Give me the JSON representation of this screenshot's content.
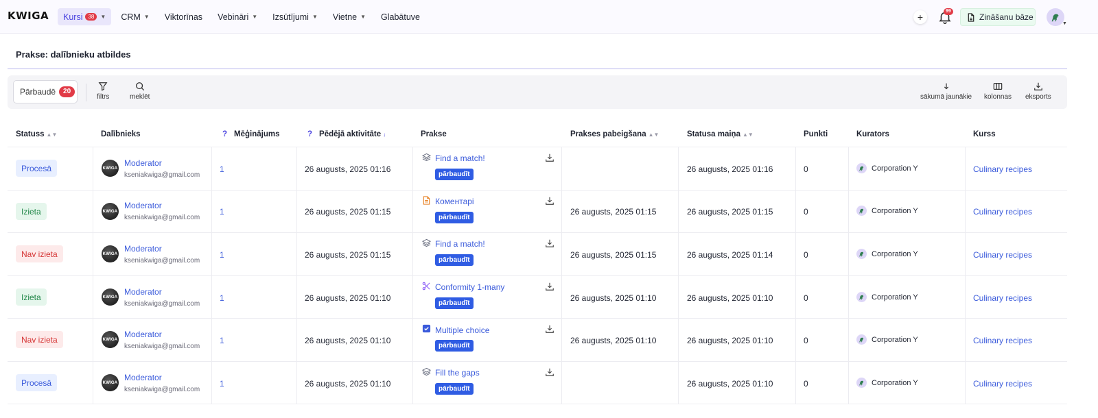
{
  "brand": "KWIGA",
  "nav": [
    {
      "label": "Kursi",
      "badge": "38",
      "chevron": true,
      "active": true
    },
    {
      "label": "CRM",
      "chevron": true
    },
    {
      "label": "Viktorīnas"
    },
    {
      "label": "Vebināri",
      "chevron": true
    },
    {
      "label": "Izsūtījumi",
      "chevron": true
    },
    {
      "label": "Vietne",
      "chevron": true
    },
    {
      "label": "Glabātuve"
    }
  ],
  "header": {
    "plus": "+",
    "notifications_badge": "99",
    "knowledge_base": "Zināšanu bāze"
  },
  "page_title": "Prakse: dalībnieku atbildes",
  "toolbar": {
    "chip_label": "Pārbaudē",
    "chip_count": "20",
    "filter": "filtrs",
    "search": "meklēt",
    "sort": "sākumā jaunākie",
    "columns": "kolonnas",
    "export": "eksports"
  },
  "columns": {
    "status": "Statuss",
    "participant": "Dalībnieks",
    "attempt_q": "?",
    "attempt": "Mēģinājums",
    "activity_q": "?",
    "activity": "Pēdējā aktivitāte",
    "practice": "Prakse",
    "completion": "Prakses pabeigšana",
    "status_change": "Statusa maiņa",
    "points": "Punkti",
    "curator": "Kurators",
    "course": "Kurss"
  },
  "rows": [
    {
      "status": "Procesā",
      "status_type": "proc",
      "name": "Moderator",
      "email": "kseniakwiga@gmail.com",
      "avatar": "KWIGA",
      "attempt": "1",
      "activity": "26 augusts, 2025 01:16",
      "practice": "Find a match!",
      "practice_icon": "layers-icon",
      "check": "pārbaudīt",
      "completion": "",
      "status_change": "26 augusts, 2025 01:16",
      "points": "0",
      "curator": "Corporation Y",
      "course": "Culinary recipes"
    },
    {
      "status": "Izieta",
      "status_type": "ok",
      "name": "Moderator",
      "email": "kseniakwiga@gmail.com",
      "avatar": "KWIGA",
      "attempt": "1",
      "activity": "26 augusts, 2025 01:15",
      "practice": "Коментарі",
      "practice_icon": "document-icon",
      "check": "pārbaudīt",
      "completion": "26 augusts, 2025 01:15",
      "status_change": "26 augusts, 2025 01:15",
      "points": "0",
      "curator": "Corporation Y",
      "course": "Culinary recipes"
    },
    {
      "status": "Nav izieta",
      "status_type": "bad",
      "name": "Moderator",
      "email": "kseniakwiga@gmail.com",
      "avatar": "KWIGA",
      "attempt": "1",
      "activity": "26 augusts, 2025 01:15",
      "practice": "Find a match!",
      "practice_icon": "layers-icon",
      "check": "pārbaudīt",
      "completion": "26 augusts, 2025 01:15",
      "status_change": "26 augusts, 2025 01:14",
      "points": "0",
      "curator": "Corporation Y",
      "course": "Culinary recipes"
    },
    {
      "status": "Izieta",
      "status_type": "ok",
      "name": "Moderator",
      "email": "kseniakwiga@gmail.com",
      "avatar": "KWIGA",
      "attempt": "1",
      "activity": "26 augusts, 2025 01:10",
      "practice": "Conformity 1-many",
      "practice_icon": "conformity-icon",
      "check": "pārbaudīt",
      "completion": "26 augusts, 2025 01:10",
      "status_change": "26 augusts, 2025 01:10",
      "points": "0",
      "curator": "Corporation Y",
      "course": "Culinary recipes"
    },
    {
      "status": "Nav izieta",
      "status_type": "bad",
      "name": "Moderator",
      "email": "kseniakwiga@gmail.com",
      "avatar": "KWIGA",
      "attempt": "1",
      "activity": "26 augusts, 2025 01:10",
      "practice": "Multiple choice",
      "practice_icon": "checkbox-icon",
      "check": "pārbaudīt",
      "completion": "26 augusts, 2025 01:10",
      "status_change": "26 augusts, 2025 01:10",
      "points": "0",
      "curator": "Corporation Y",
      "course": "Culinary recipes"
    },
    {
      "status": "Procesā",
      "status_type": "proc",
      "name": "Moderator",
      "email": "kseniakwiga@gmail.com",
      "avatar": "KWIGA",
      "attempt": "1",
      "activity": "26 augusts, 2025 01:10",
      "practice": "Fill the gaps",
      "practice_icon": "layers-icon",
      "check": "pārbaudīt",
      "completion": "",
      "status_change": "26 augusts, 2025 01:10",
      "points": "0",
      "curator": "Corporation Y",
      "course": "Culinary recipes"
    }
  ],
  "colors": {
    "accent": "#4a43e0",
    "link": "#3b5bdb",
    "check_button": "#2f5ce3",
    "badge": "#e13a46"
  }
}
